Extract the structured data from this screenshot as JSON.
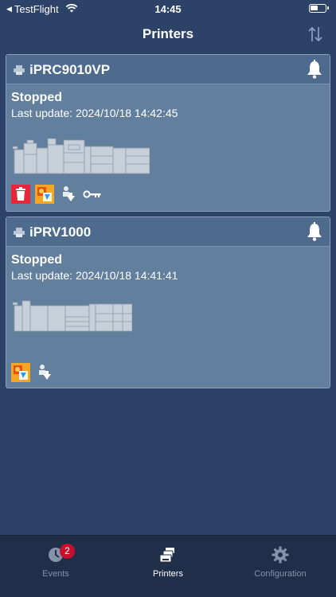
{
  "status_bar": {
    "back_app": "TestFlight",
    "time": "14:45"
  },
  "nav": {
    "title": "Printers",
    "sort_icon": "sort-arrows-icon"
  },
  "printers": [
    {
      "name": "iPRC9010VP",
      "status": "Stopped",
      "last_update": "Last update: 2024/10/18 14:42:45",
      "icons": [
        "trash-icon",
        "color-management-icon",
        "download-job-icon",
        "key-icon"
      ]
    },
    {
      "name": "iPRV1000",
      "status": "Stopped",
      "last_update": "Last update: 2024/10/18 14:41:41",
      "icons": [
        "color-management-icon",
        "download-job-icon"
      ]
    }
  ],
  "tabs": [
    {
      "label": "Events",
      "badge": "2",
      "icon": "events-clock-icon"
    },
    {
      "label": "Printers",
      "icon": "printers-stack-icon",
      "active": true
    },
    {
      "label": "Configuration",
      "icon": "gear-icon"
    }
  ],
  "colors": {
    "background": "#2c4266",
    "card": "#637f9e",
    "card_header": "#4e6a8d",
    "tab_bar": "#1f2f49",
    "badge": "#c8102e",
    "delete": "#e8263a",
    "color_mgmt": "#f5a623"
  }
}
